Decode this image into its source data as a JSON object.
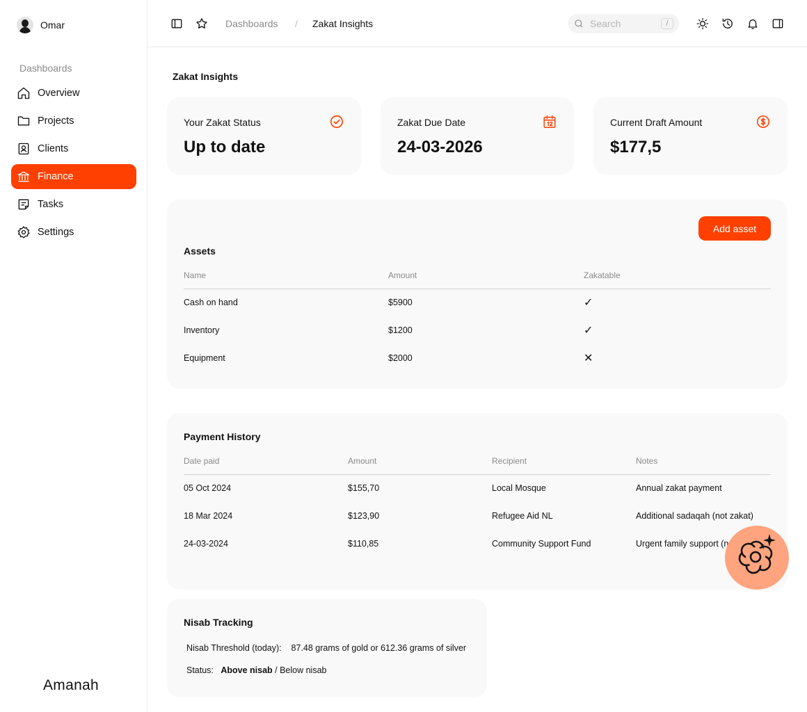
{
  "user": {
    "name": "Omar"
  },
  "sidebar": {
    "section": "Dashboards",
    "items": [
      {
        "label": "Overview",
        "icon": "home-icon"
      },
      {
        "label": "Projects",
        "icon": "folder-icon"
      },
      {
        "label": "Clients",
        "icon": "contact-icon"
      },
      {
        "label": "Finance",
        "icon": "bank-icon",
        "active": true
      },
      {
        "label": "Tasks",
        "icon": "note-icon"
      },
      {
        "label": "Settings",
        "icon": "gear-icon"
      }
    ],
    "brand": "Amanah"
  },
  "topbar": {
    "breadcrumb_parent": "Dashboards",
    "breadcrumb_sep": "/",
    "breadcrumb_current": "Zakat Insights",
    "search_placeholder": "Search",
    "search_shortcut": "/"
  },
  "page": {
    "title": "Zakat Insights"
  },
  "stats": [
    {
      "label": "Your Zakat Status",
      "value": "Up to date",
      "icon": "check-circle-icon"
    },
    {
      "label": "Zakat Due Date",
      "value": "24-03-2026",
      "icon": "calendar-icon"
    },
    {
      "label": "Current Draft Amount",
      "value": "$177,5",
      "icon": "dollar-circle-icon"
    }
  ],
  "assets": {
    "title": "Assets",
    "add_label": "Add asset",
    "columns": [
      "Name",
      "Amount",
      "Zakatable"
    ],
    "rows": [
      {
        "name": "Cash on hand",
        "amount": "$5900",
        "zakatable": "✓"
      },
      {
        "name": "Inventory",
        "amount": "$1200",
        "zakatable": "✓"
      },
      {
        "name": "Equipment",
        "amount": "$2000",
        "zakatable": "✕"
      }
    ]
  },
  "payments": {
    "title": "Payment History",
    "columns": [
      "Date paid",
      "Amount",
      "Recipient",
      "Notes"
    ],
    "rows": [
      {
        "date": "05 Oct 2024",
        "amount": "$155,70",
        "recipient": "Local Mosque",
        "notes": "Annual zakat payment"
      },
      {
        "date": "18 Mar 2024",
        "amount": "$123,90",
        "recipient": "Refugee Aid NL",
        "notes": "Additional sadaqah (not zakat)"
      },
      {
        "date": "24-03-2024",
        "amount": "$110,85",
        "recipient": "Community Support Fund",
        "notes": "Urgent family support (not zakat)"
      }
    ]
  },
  "nisab": {
    "title": "Nisab Tracking",
    "threshold_label": "Nisab Threshold (today):",
    "threshold_value": "87.48 grams of gold or 612.36 grams of silver",
    "status_label": "Status:",
    "status_above": "Above nisab",
    "status_rest": " / Below nisab"
  },
  "colors": {
    "accent": "#ff4000",
    "card_bg": "#f9f9f9",
    "fab": "#ffa47e"
  }
}
